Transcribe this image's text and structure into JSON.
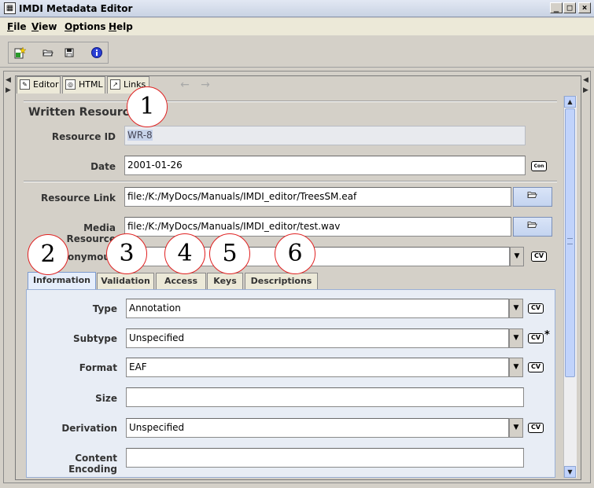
{
  "window": {
    "title": "IMDI Metadata Editor"
  },
  "menu": [
    {
      "underline": "F",
      "rest": "ile"
    },
    {
      "underline": "V",
      "rest": "iew"
    },
    {
      "underline": "O",
      "rest": "ptions"
    },
    {
      "underline": "H",
      "rest": "elp"
    }
  ],
  "view_tabs": {
    "editor": "Editor",
    "html": "HTML",
    "links": "Links"
  },
  "section_title": "Written Resource",
  "fields": {
    "resource_id": {
      "label": "Resource ID",
      "value": "WR-8"
    },
    "date": {
      "label": "Date",
      "value": "2001-01-26",
      "button": "Con"
    },
    "resource_link": {
      "label": "Resource Link",
      "value": "file:/K:/MyDocs/Manuals/IMDI_editor/TreesSM.eaf"
    },
    "media_resource": {
      "label": "Media Resource",
      "value": "file:/K:/MyDocs/Manuals/IMDI_editor/test.wav"
    },
    "anonymous": {
      "label": "Anonymous",
      "value": ""
    }
  },
  "subtabs": [
    "Information",
    "Validation",
    "Access",
    "Keys",
    "Descriptions"
  ],
  "info_fields": {
    "type": {
      "label": "Type",
      "value": "Annotation",
      "cv": "CV"
    },
    "subtype": {
      "label": "Subtype",
      "value": "Unspecified",
      "cv": "CV",
      "star": "*"
    },
    "format": {
      "label": "Format",
      "value": "EAF",
      "cv": "CV"
    },
    "size": {
      "label": "Size",
      "value": ""
    },
    "derivation": {
      "label": "Derivation",
      "value": "Unspecified",
      "cv": "CV"
    },
    "content_encoding": {
      "label": "Content Encoding",
      "value": ""
    }
  },
  "callouts": [
    "1",
    "2",
    "3",
    "4",
    "5",
    "6"
  ],
  "icons": {
    "new": "new-document-icon",
    "open": "open-folder-icon",
    "save": "save-disk-icon",
    "info": "info-icon"
  },
  "colors": {
    "scroll_accent": "#c1d3fb",
    "callout_border": "#e02020",
    "active_tab": "#e6eefb"
  }
}
